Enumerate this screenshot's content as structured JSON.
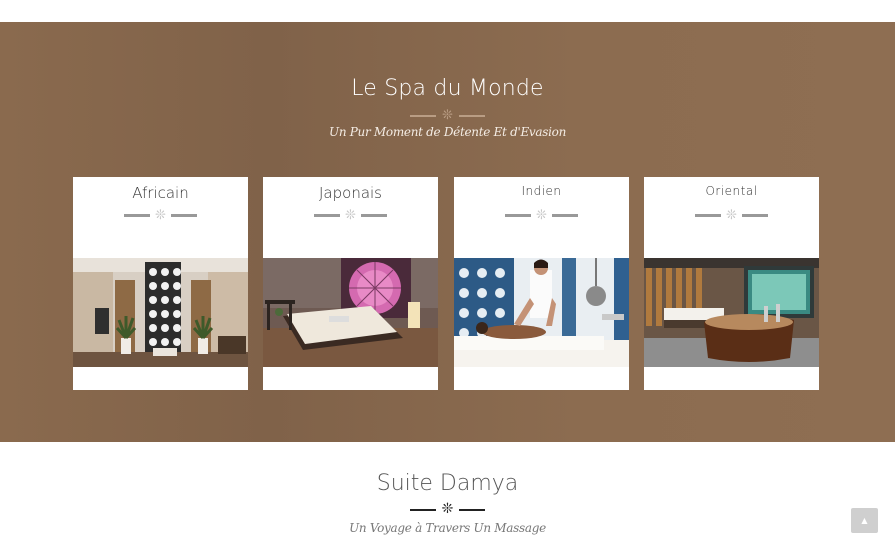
{
  "spa_section": {
    "title": "Le Spa du Monde",
    "subtitle": "Un Pur Moment de Détente Et d'Evasion",
    "cards": [
      {
        "title": "Africain",
        "image": "african-spa-room"
      },
      {
        "title": "Japonais",
        "image": "japanese-spa-room"
      },
      {
        "title": "Indien",
        "image": "indian-massage-room"
      },
      {
        "title": "Oriental",
        "image": "oriental-bath-room"
      }
    ]
  },
  "suite_section": {
    "title": "Suite Damya",
    "subtitle": "Un Voyage à Travers Un Massage"
  },
  "scroll_top": {
    "icon": "chevron-up-icon",
    "glyph": "▲"
  },
  "colors": {
    "band_background": "#8a6a4e",
    "card_background": "#ffffff",
    "divider_dark": "#222222"
  }
}
